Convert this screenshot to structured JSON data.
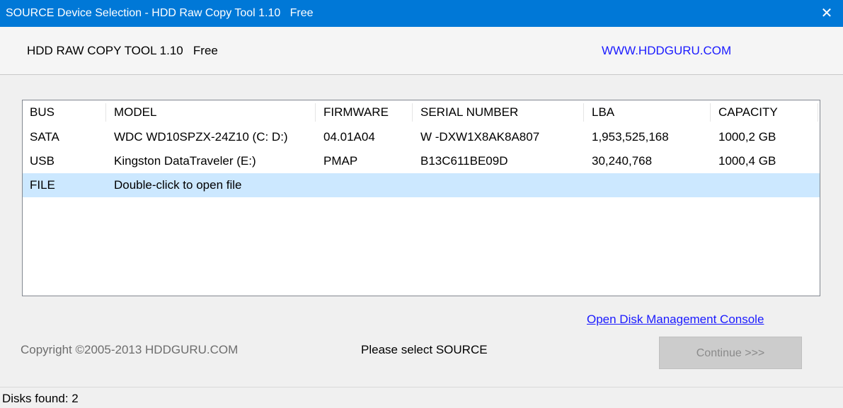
{
  "window": {
    "title": "SOURCE Device Selection - HDD Raw Copy Tool 1.10   Free",
    "close_glyph": "✕"
  },
  "header": {
    "app_name": "HDD RAW COPY TOOL 1.10   Free",
    "website": "WWW.HDDGURU.COM"
  },
  "device_list": {
    "columns": [
      "BUS",
      "MODEL",
      "FIRMWARE",
      "SERIAL NUMBER",
      "LBA",
      "CAPACITY"
    ],
    "rows": [
      {
        "bus": "SATA",
        "model": "WDC WD10SPZX-24Z10 (C: D:)",
        "firmware": "04.01A04",
        "serial": "W -DXW1X8AK8A807",
        "lba": "1,953,525,168",
        "capacity": "1000,2 GB"
      },
      {
        "bus": "USB",
        "model": "Kingston DataTraveler  (E:)",
        "firmware": "PMAP",
        "serial": "B13C611BE09D",
        "lba": "30,240,768",
        "capacity": "1000,4 GB"
      },
      {
        "bus": "FILE",
        "model": "Double-click to open file",
        "firmware": "",
        "serial": "",
        "lba": "",
        "capacity": ""
      }
    ],
    "selected_color": "#cce8ff"
  },
  "actions": {
    "disk_management_link": "Open Disk Management Console",
    "continue_label": "Continue >>>"
  },
  "footer": {
    "copyright": "Copyright ©2005-2013 HDDGURU.COM",
    "status_message": "Please select SOURCE",
    "disks_found": "Disks found: 2"
  },
  "colors": {
    "titlebar": "#0078d7",
    "link": "#1a1aff"
  }
}
